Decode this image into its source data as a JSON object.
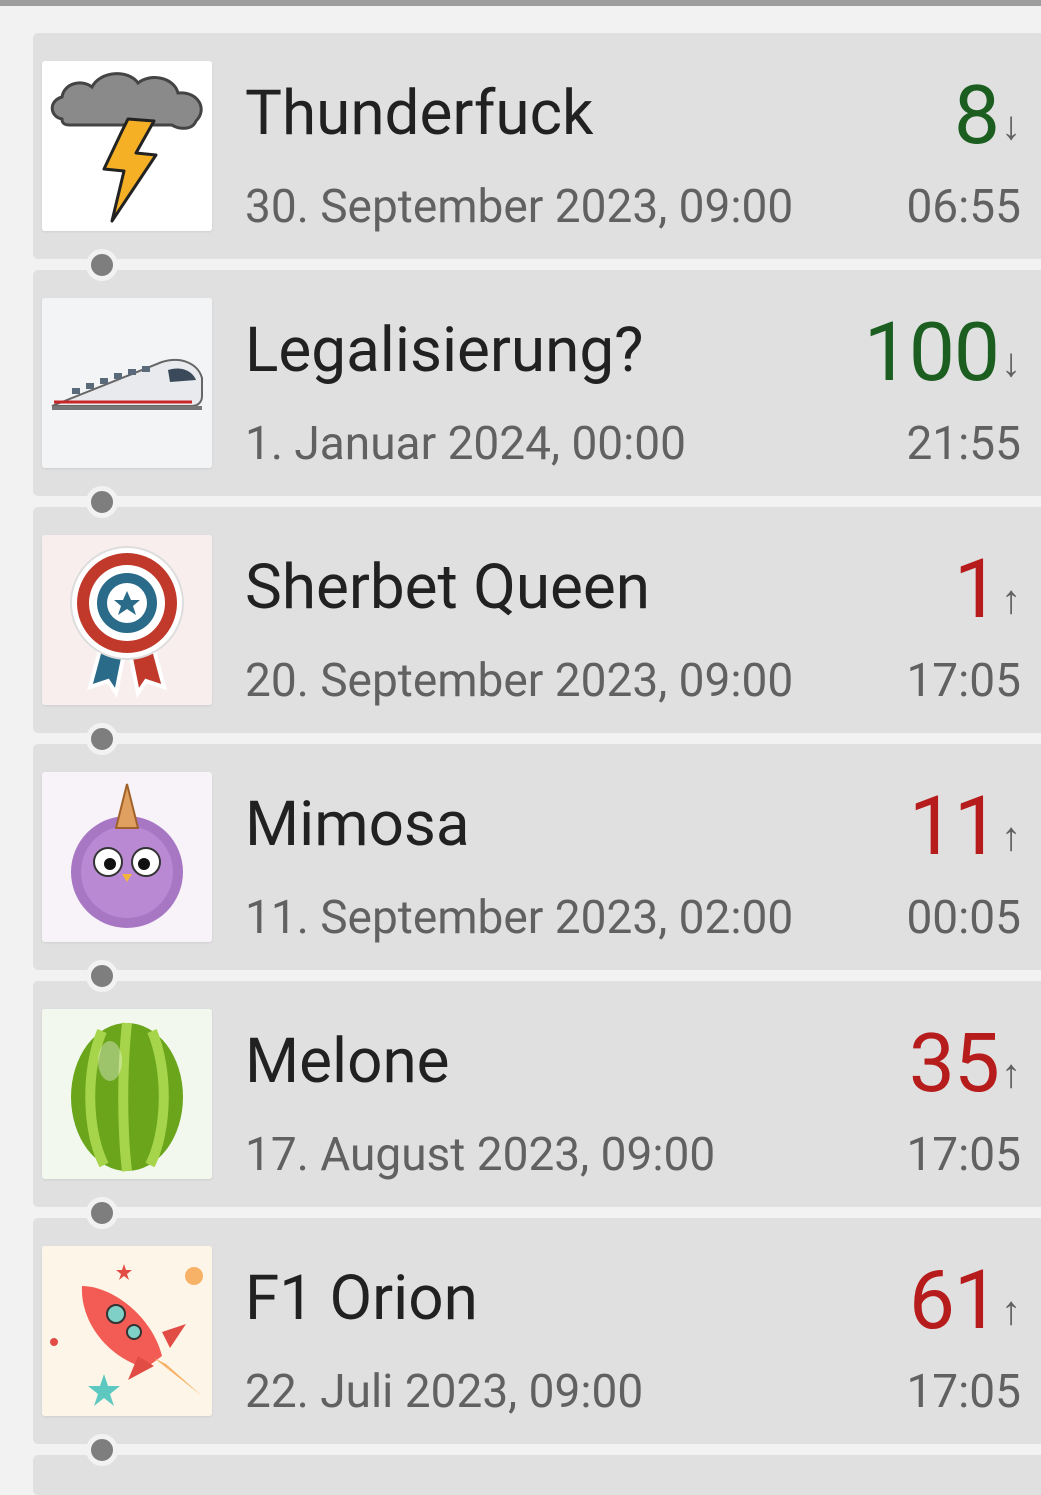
{
  "colors": {
    "down_value": "#1b5e20",
    "up_value": "#b71c1c",
    "card_bg": "#e0e0e0",
    "page_bg": "#f2f2f2"
  },
  "items": [
    {
      "name": "Thunderfuck",
      "date": "30. September 2023, 09:00",
      "value": "8",
      "trend": "↓",
      "time": "06:55",
      "icon": "thunderstorm-cloud-icon"
    },
    {
      "name": "Legalisierung?",
      "date": "1. Januar 2024, 00:00",
      "value": "100",
      "trend": "↓",
      "time": "21:55",
      "icon": "high-speed-train-icon"
    },
    {
      "name": "Sherbet Queen",
      "date": "20. September 2023, 09:00",
      "value": "1",
      "trend": "↑",
      "time": "17:05",
      "icon": "award-rosette-icon"
    },
    {
      "name": "Mimosa",
      "date": "11. September 2023, 02:00",
      "value": "11",
      "trend": "↑",
      "time": "00:05",
      "icon": "purple-fluffy-monster-icon"
    },
    {
      "name": "Melone",
      "date": "17. August 2023, 09:00",
      "value": "35",
      "trend": "↑",
      "time": "17:05",
      "icon": "green-melon-egg-icon"
    },
    {
      "name": "F1 Orion",
      "date": "22. Juli 2023, 09:00",
      "value": "61",
      "trend": "↑",
      "time": "17:05",
      "icon": "rocket-icon"
    }
  ]
}
